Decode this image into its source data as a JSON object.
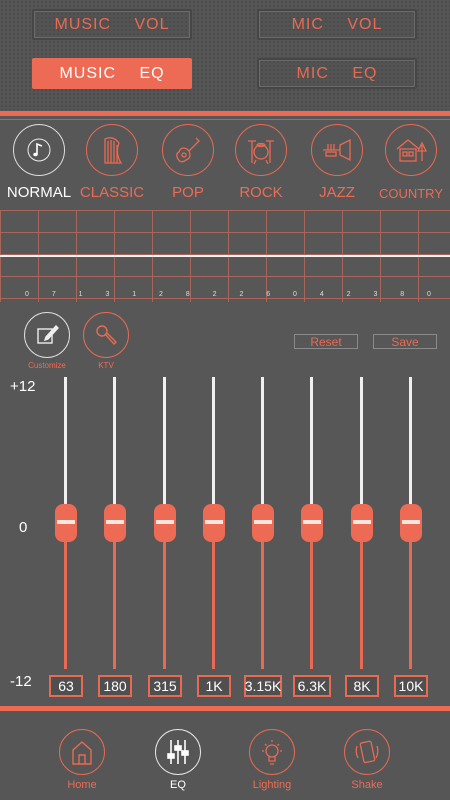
{
  "top_buttons": {
    "music_vol": "MUSIC  VOL",
    "mic_vol": "MIC  VOL",
    "music_eq": "MUSIC  EQ",
    "mic_eq": "MIC  EQ"
  },
  "presets": [
    {
      "label": "NORMAL",
      "icon": "music-note-icon",
      "active": true
    },
    {
      "label": "CLASSIC",
      "icon": "harp-icon"
    },
    {
      "label": "POP",
      "icon": "guitar-icon"
    },
    {
      "label": "ROCK",
      "icon": "drum-kit-icon"
    },
    {
      "label": "JAZZ",
      "icon": "trumpet-icon"
    },
    {
      "label": "COUNTRY",
      "icon": "house-icon"
    }
  ],
  "readout_digits": [
    "0",
    "7",
    "1",
    "3",
    "1",
    "2",
    "8",
    "2",
    "2",
    "6",
    "0",
    "4",
    "2",
    "3",
    "8",
    "0"
  ],
  "tools": {
    "customize": "Customize",
    "ktv": "KTV",
    "reset": "Reset",
    "save": "Save"
  },
  "scale": {
    "max": "+12",
    "mid": "0",
    "min": "-12"
  },
  "bands": [
    {
      "label": "63",
      "value": 0
    },
    {
      "label": "180",
      "value": 0
    },
    {
      "label": "315",
      "value": 0
    },
    {
      "label": "1K",
      "value": 0
    },
    {
      "label": "3.15K",
      "value": 0
    },
    {
      "label": "6.3K",
      "value": 0
    },
    {
      "label": "8K",
      "value": 0
    },
    {
      "label": "10K",
      "value": 0
    }
  ],
  "nav": {
    "home": "Home",
    "eq": "EQ",
    "lighting": "Lighting",
    "shake": "Shake"
  },
  "colors": {
    "accent": "#ed6b54",
    "background": "#575757"
  }
}
